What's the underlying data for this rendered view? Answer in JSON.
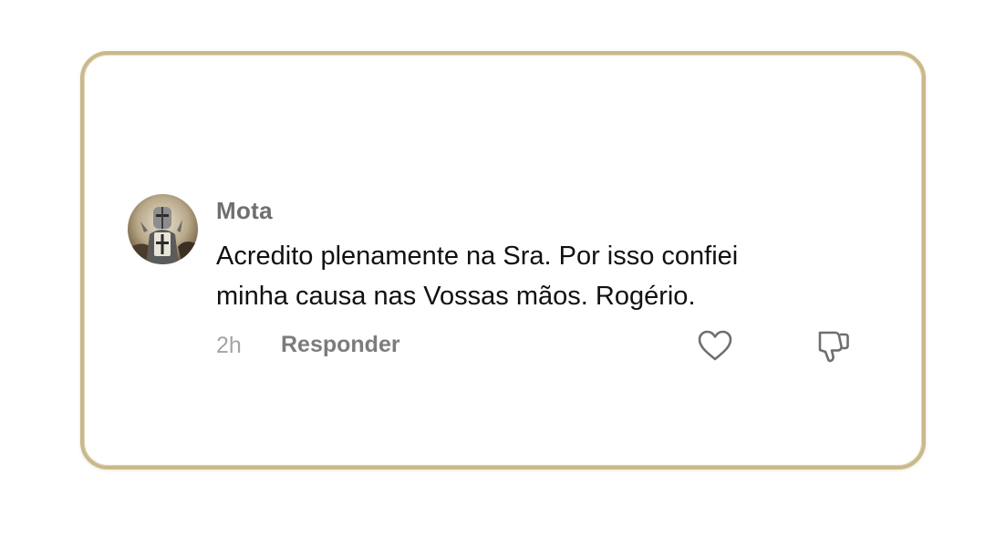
{
  "comment": {
    "author": "Mota",
    "avatar_icon": "knight-avatar",
    "text_lines": [
      "Acredito plenamente na Sra. Por isso confiei",
      "minha causa nas Vossas mãos. Rogério."
    ],
    "timestamp": "2h",
    "reply_label": "Responder",
    "like_icon": "heart-icon",
    "dislike_icon": "thumbs-down-icon"
  },
  "colors": {
    "card_border": "#c9b98a",
    "username": "#6f6f6f",
    "text": "#111111",
    "meta": "#a4a4a4",
    "reply": "#7c7c7c"
  }
}
